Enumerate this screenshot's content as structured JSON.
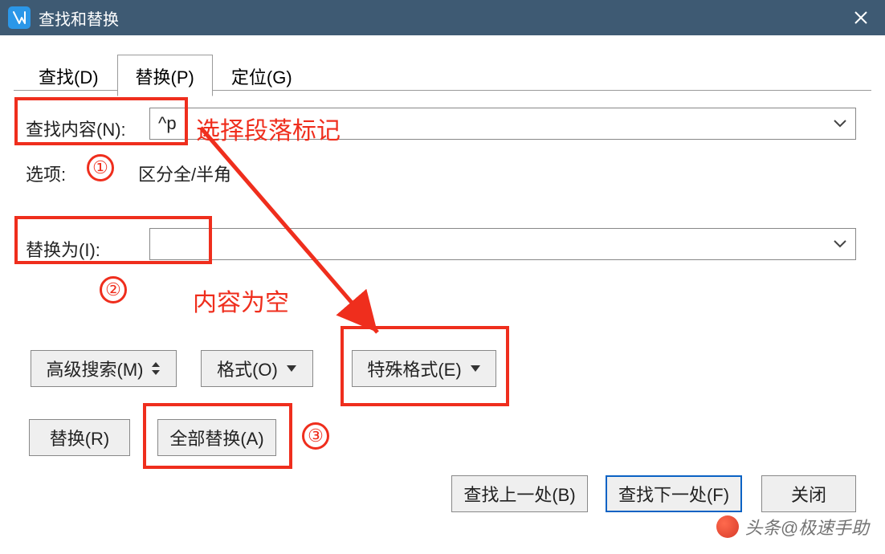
{
  "window": {
    "title": "查找和替换",
    "close_label": "关闭窗口"
  },
  "tabs": {
    "find": "查找(D)",
    "replace": "替换(P)",
    "goto": "定位(G)"
  },
  "find": {
    "label": "查找内容(N):",
    "value": "^p"
  },
  "options": {
    "label": "选项:",
    "value": "区分全/半角"
  },
  "replace_with": {
    "label": "替换为(I):",
    "value": ""
  },
  "opt_buttons": {
    "advanced": "高级搜索(M)",
    "format": "格式(O)",
    "special": "特殊格式(E)"
  },
  "bottom": {
    "replace": "替换(R)",
    "replace_all": "全部替换(A)",
    "find_prev": "查找上一处(B)",
    "find_next": "查找下一处(F)",
    "close": "关闭"
  },
  "annotations": {
    "note1": "选择段落标记",
    "note2": "内容为空",
    "n1": "①",
    "n2": "②",
    "n3": "③"
  },
  "watermark": "头条@极速手助"
}
